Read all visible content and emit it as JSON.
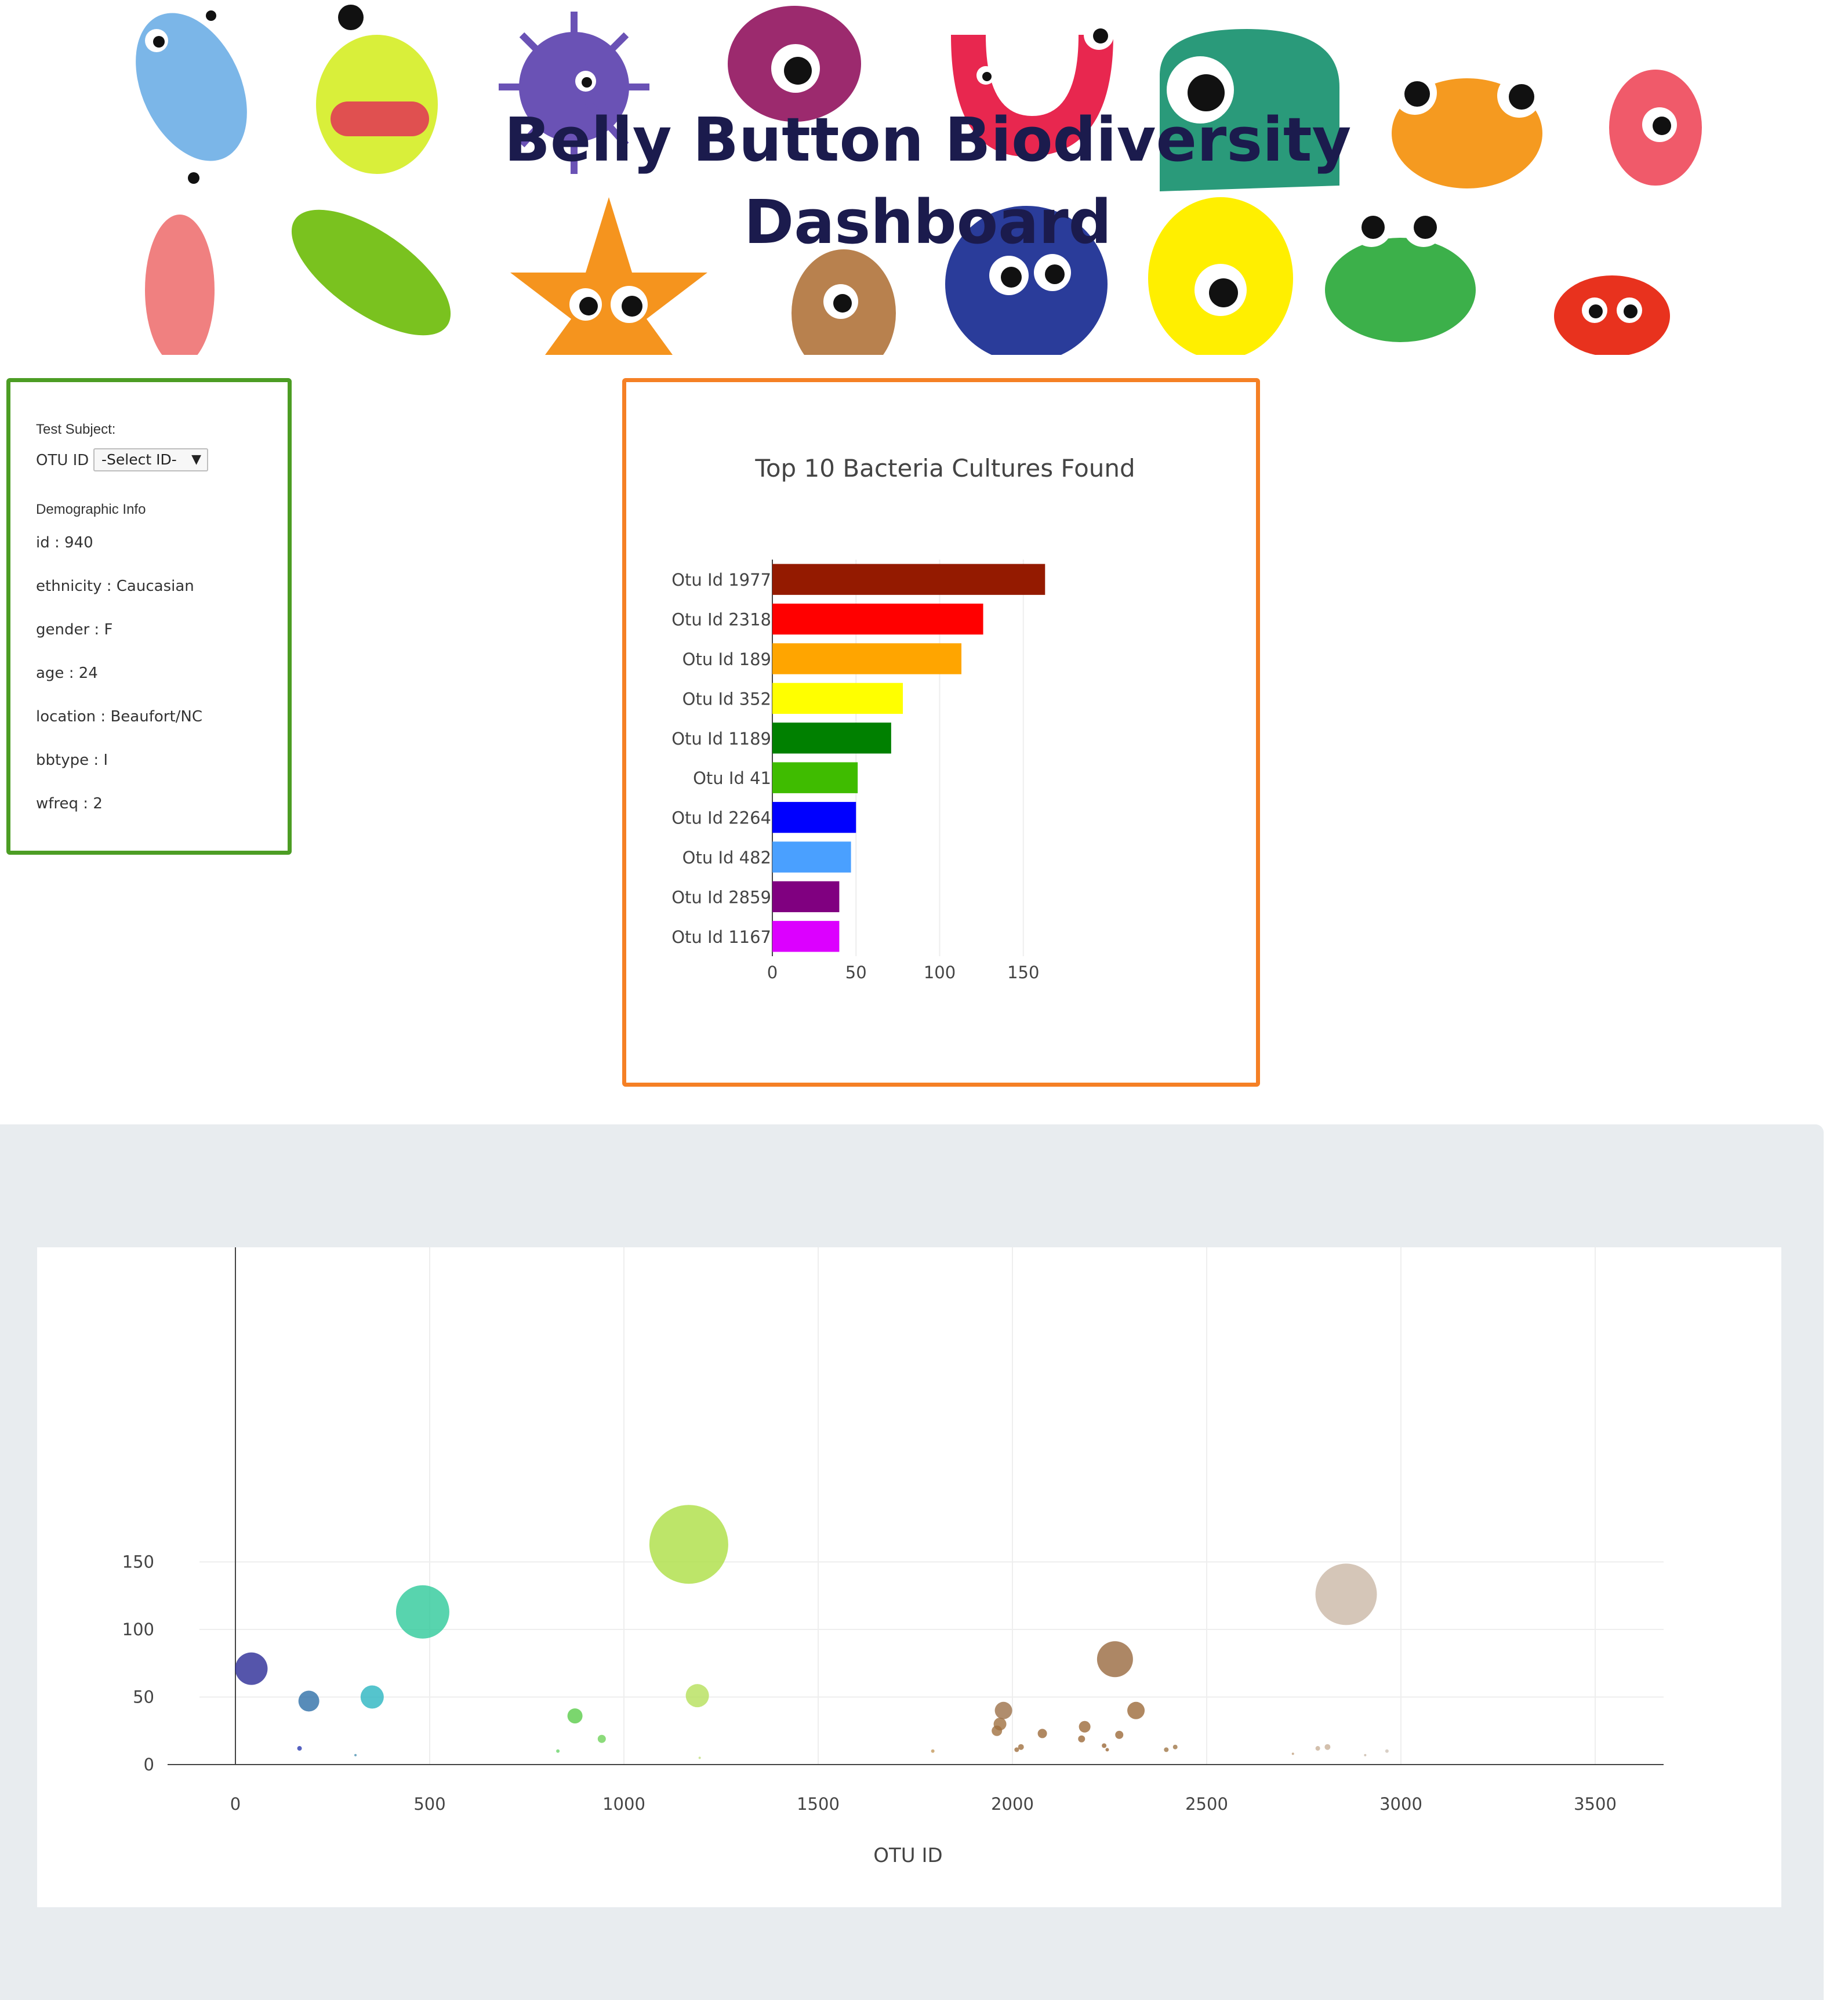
{
  "header": {
    "title_line1": "Belly Button Biodiversity",
    "title_line2": "Dashboard"
  },
  "metadata_panel": {
    "test_subject_label": "Test Subject:",
    "otu_label": "OTU ID",
    "select_value": "-Select ID-",
    "demographic_label": "Demographic Info",
    "rows": [
      {
        "key": "id",
        "value": "940"
      },
      {
        "key": "ethnicity",
        "value": "Caucasian"
      },
      {
        "key": "gender",
        "value": "F"
      },
      {
        "key": "age",
        "value": "24"
      },
      {
        "key": "location",
        "value": "Beaufort/NC"
      },
      {
        "key": "bbtype",
        "value": "I"
      },
      {
        "key": "wfreq",
        "value": "2"
      }
    ]
  },
  "chart_data": [
    {
      "type": "bar",
      "orientation": "horizontal",
      "title": "Top 10 Bacteria Cultures Found",
      "categories": [
        "Otu Id 1977",
        "Otu Id 2318",
        "Otu Id 189",
        "Otu Id 352",
        "Otu Id 1189",
        "Otu Id 41",
        "Otu Id 2264",
        "Otu Id 482",
        "Otu Id 2859",
        "Otu Id 1167"
      ],
      "values": [
        163,
        126,
        113,
        78,
        71,
        51,
        50,
        47,
        40,
        40
      ],
      "colors": [
        "#941a00",
        "#ff0000",
        "#ffa500",
        "#ffff00",
        "#008000",
        "#3fbc00",
        "#0000ff",
        "#4aa0ff",
        "#800080",
        "#dc00ff"
      ],
      "xlim": [
        0,
        183
      ],
      "xticks": [
        0,
        50,
        100,
        150
      ],
      "grid": true
    },
    {
      "type": "scatter",
      "subtype": "bubble",
      "xlabel": "OTU ID",
      "ylabel": "",
      "xlim": [
        -200,
        3680
      ],
      "ylim": [
        -10,
        190
      ],
      "xticks": [
        0,
        500,
        1000,
        1500,
        2000,
        2500,
        3000,
        3500
      ],
      "yticks": [
        0,
        50,
        100,
        150
      ],
      "grid": true,
      "points": [
        {
          "x": 41,
          "y": 71,
          "color": "#2a2a96"
        },
        {
          "x": 165,
          "y": 12,
          "color": "#2a3ab0"
        },
        {
          "x": 189,
          "y": 47,
          "color": "#2e6fa8"
        },
        {
          "x": 309,
          "y": 7,
          "color": "#4a90b0"
        },
        {
          "x": 352,
          "y": 50,
          "color": "#2bb5c0"
        },
        {
          "x": 482,
          "y": 113,
          "color": "#2ec99a"
        },
        {
          "x": 830,
          "y": 10,
          "color": "#6bd46b"
        },
        {
          "x": 874,
          "y": 36,
          "color": "#5acc4a"
        },
        {
          "x": 943,
          "y": 19,
          "color": "#6fd25a"
        },
        {
          "x": 1167,
          "y": 163,
          "color": "#acdf44"
        },
        {
          "x": 1189,
          "y": 51,
          "color": "#b5e05a"
        },
        {
          "x": 1195,
          "y": 5,
          "color": "#c0e080"
        },
        {
          "x": 1795,
          "y": 10,
          "color": "#c49a5c"
        },
        {
          "x": 1960,
          "y": 25,
          "color": "#a07040"
        },
        {
          "x": 1968,
          "y": 30,
          "color": "#a07040"
        },
        {
          "x": 1977,
          "y": 40,
          "color": "#9c7048"
        },
        {
          "x": 2011,
          "y": 11,
          "color": "#a07040"
        },
        {
          "x": 2022,
          "y": 13,
          "color": "#a07040"
        },
        {
          "x": 2077,
          "y": 23,
          "color": "#9c6a3a"
        },
        {
          "x": 2178,
          "y": 19,
          "color": "#9c6a3a"
        },
        {
          "x": 2186,
          "y": 28,
          "color": "#9c6a3a"
        },
        {
          "x": 2236,
          "y": 14,
          "color": "#9c6a3a"
        },
        {
          "x": 2244,
          "y": 11,
          "color": "#9c6a3a"
        },
        {
          "x": 2264,
          "y": 78,
          "color": "#98693e"
        },
        {
          "x": 2275,
          "y": 22,
          "color": "#9c6a3a"
        },
        {
          "x": 2318,
          "y": 40,
          "color": "#9c6a3a"
        },
        {
          "x": 2396,
          "y": 11,
          "color": "#a07848"
        },
        {
          "x": 2419,
          "y": 13,
          "color": "#a07848"
        },
        {
          "x": 2722,
          "y": 8,
          "color": "#c0a080"
        },
        {
          "x": 2786,
          "y": 12,
          "color": "#c8b098"
        },
        {
          "x": 2811,
          "y": 13,
          "color": "#c8b098"
        },
        {
          "x": 2859,
          "y": 126,
          "color": "#cbb8a6"
        },
        {
          "x": 2908,
          "y": 7,
          "color": "#c8b8a8"
        },
        {
          "x": 2964,
          "y": 10,
          "color": "#d0c4b8"
        }
      ],
      "radii": [
        28,
        4,
        18,
        2,
        20,
        46,
        3,
        13,
        7,
        68,
        20,
        2,
        3,
        9,
        11,
        15,
        4,
        5,
        8,
        6,
        10,
        4,
        3,
        31,
        7,
        15,
        4,
        4,
        2,
        4,
        5,
        53,
        2,
        3
      ]
    }
  ]
}
